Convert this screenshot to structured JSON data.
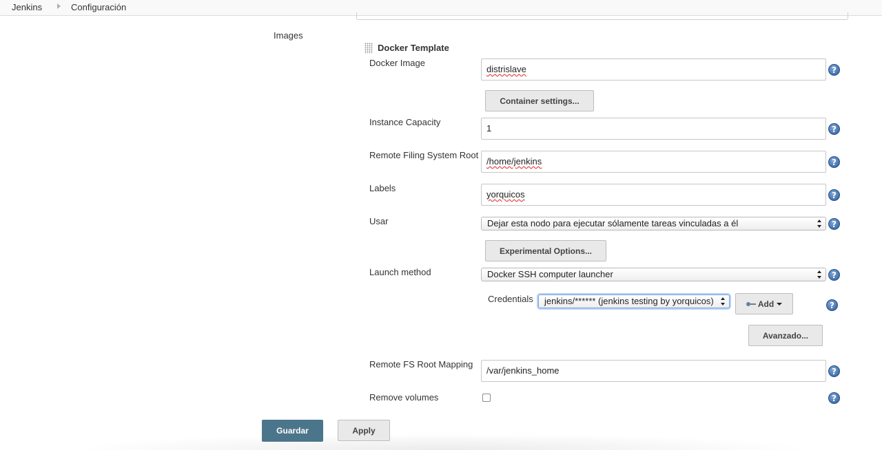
{
  "breadcrumbs": [
    "Jenkins",
    "Configuración"
  ],
  "images_label": "Images",
  "docker_template": {
    "title": "Docker Template",
    "docker_image": {
      "label": "Docker Image",
      "value": "distrislave"
    },
    "container_settings_button": "Container settings...",
    "instance_capacity": {
      "label": "Instance Capacity",
      "value": "1"
    },
    "remote_fs_root": {
      "label": "Remote Filing System Root",
      "value": "/home/jenkins"
    },
    "labels": {
      "label": "Labels",
      "value": "yorquicos"
    },
    "usage": {
      "label": "Usar",
      "value": "Dejar esta nodo para ejecutar sólamente tareas vinculadas a él"
    },
    "experimental_options_button": "Experimental Options...",
    "launch_method": {
      "label": "Launch method",
      "value": "Docker SSH computer launcher"
    },
    "credentials": {
      "label": "Credentials",
      "value": "jenkins/****** (jenkins testing by yorquicos)"
    },
    "add_button": "Add",
    "advanced_button": "Avanzado...",
    "remote_fs_root_mapping": {
      "label": "Remote FS Root Mapping",
      "value": "/var/jenkins_home"
    },
    "remove_volumes": {
      "label": "Remove volumes",
      "checked": false
    }
  },
  "help_glyph": "?",
  "footer": {
    "save_button": "Guardar",
    "apply_button": "Apply"
  },
  "colors": {
    "primary_button": "#4b758b",
    "help_icon": "#2b5d9e",
    "focus_ring": "#b5d0f5"
  },
  "icons": [
    "help-icon",
    "key-icon",
    "caret-down-icon",
    "drag-handle-icon"
  ]
}
